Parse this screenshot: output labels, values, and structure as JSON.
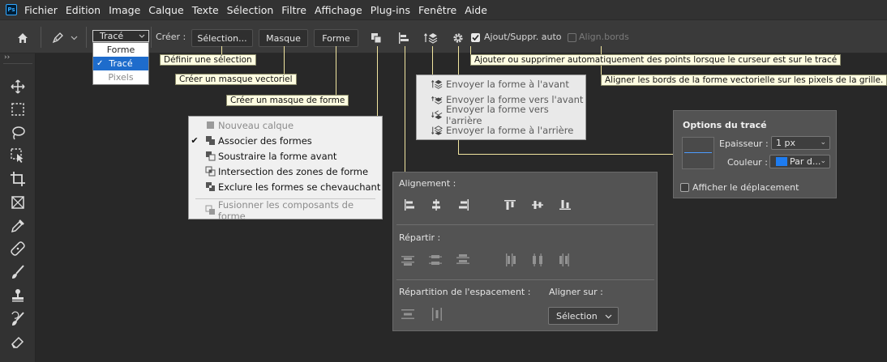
{
  "app": {
    "logo_text": "Ps"
  },
  "menubar": {
    "items": [
      "Fichier",
      "Edition",
      "Image",
      "Calque",
      "Texte",
      "Sélection",
      "Filtre",
      "Affichage",
      "Plug-ins",
      "Fenêtre",
      "Aide"
    ]
  },
  "optionsbar": {
    "mode_value": "Tracé",
    "create_label": "Créer :",
    "selection_button": "Sélection...",
    "mask_button": "Masque",
    "shape_button": "Forme",
    "auto_add_label": "Ajout/Suppr. auto",
    "align_edges_label": "Align.bords",
    "auto_add_checked": true,
    "align_edges_checked": false
  },
  "mode_dropdown": {
    "options": [
      {
        "label": "Forme",
        "selected": false,
        "disabled": false
      },
      {
        "label": "Tracé",
        "selected": true,
        "disabled": false
      },
      {
        "label": "Pixels",
        "selected": false,
        "disabled": true
      }
    ]
  },
  "tooltips": {
    "define_selection": "Définir une sélection",
    "vector_mask": "Créer un masque vectoriel",
    "shape_mask": "Créer un masque de forme",
    "auto_add": "Ajouter ou supprimer automatiquement des points lorsque le curseur est sur le tracé",
    "align_edges": "Aligner les bords de la forme vectorielle sur les pixels de la grille."
  },
  "path_operations": {
    "items": [
      {
        "label": "Nouveau calque",
        "checked": false,
        "disabled": true
      },
      {
        "label": "Associer des formes",
        "checked": true,
        "disabled": false
      },
      {
        "label": "Soustraire la forme avant",
        "checked": false,
        "disabled": false
      },
      {
        "label": "Intersection des zones de forme",
        "checked": false,
        "disabled": false
      },
      {
        "label": "Exclure les formes se chevauchant",
        "checked": false,
        "disabled": false
      },
      {
        "label": "Fusionner les composants de forme",
        "checked": false,
        "disabled": true
      }
    ]
  },
  "arrange_menu": {
    "items": [
      "Envoyer la forme à l'avant",
      "Envoyer la forme vers l'avant",
      "Envoyer la forme vers l'arrière",
      "Envoyer la forme à l'arrière"
    ]
  },
  "align_panel": {
    "alignment_label": "Alignement :",
    "distribute_label": "Répartir :",
    "spacing_label": "Répartition de l'espacement :",
    "align_to_label": "Aligner sur :",
    "align_to_value": "Sélection"
  },
  "path_options": {
    "title": "Options du tracé",
    "thickness_label": "Epaisseur :",
    "thickness_value": "1 px",
    "color_label": "Couleur :",
    "color_value": "Par d...",
    "color_swatch": "#1e7cf0",
    "show_move_label": "Afficher le déplacement",
    "show_move_checked": false
  },
  "colors": {
    "accent": "#1e6ccc",
    "tooltip_bg": "#fffde1",
    "panel_bg": "#535353"
  }
}
